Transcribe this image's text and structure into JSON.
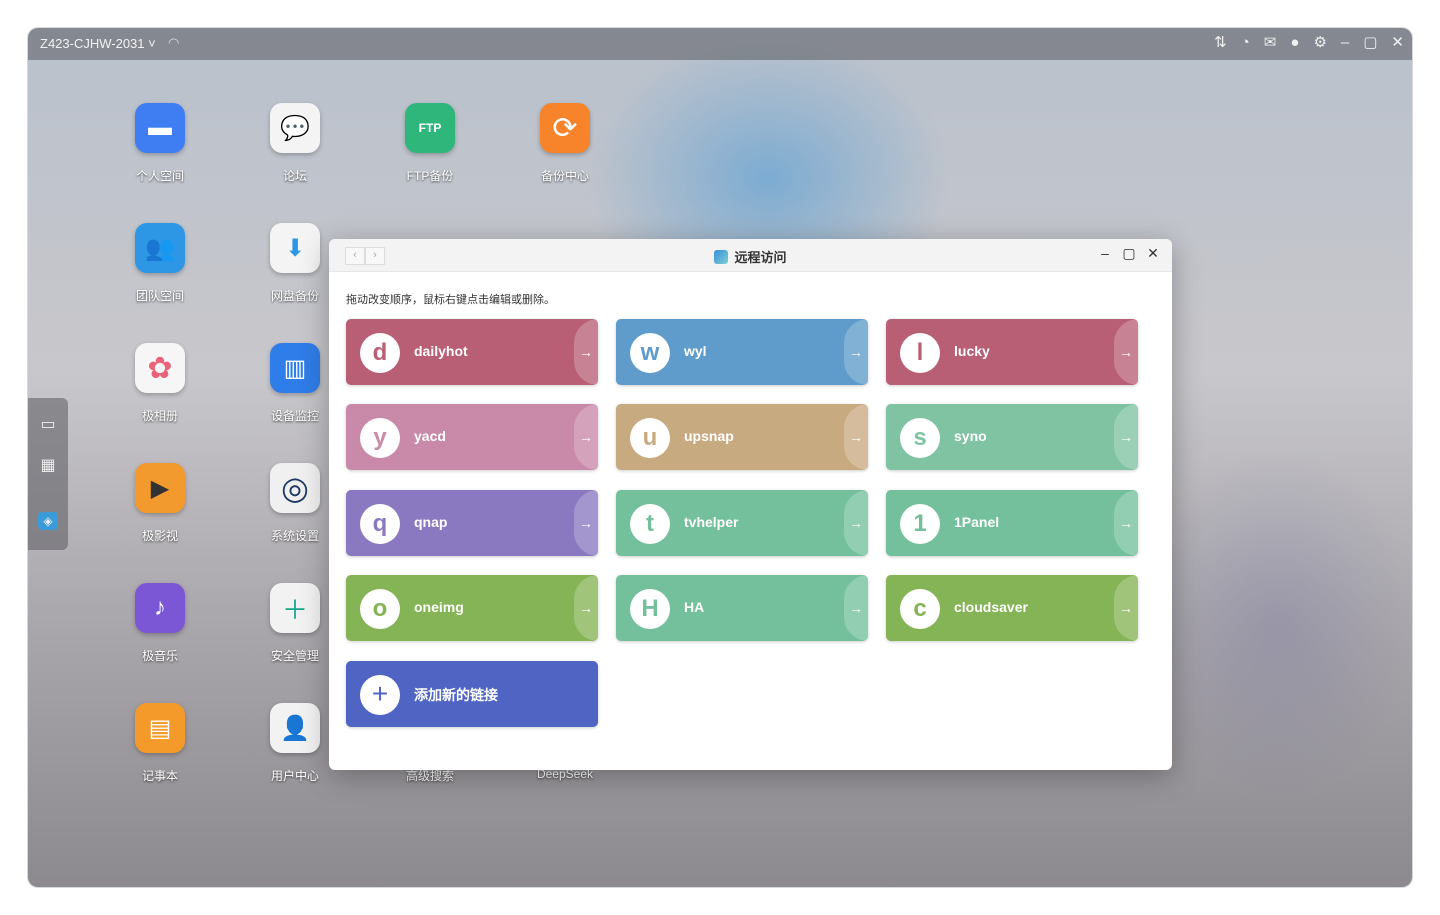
{
  "topbar": {
    "device": "Z423-CJHW-2031 ˅",
    "icons": [
      "transfer-icon",
      "speedometer-icon",
      "mail-icon",
      "user-icon",
      "gear-icon",
      "minimize-icon",
      "maximize-icon",
      "close-icon"
    ]
  },
  "desktop": {
    "apps": [
      {
        "label": "个人空间",
        "glyph": "▬",
        "color": "#3f7ef2"
      },
      {
        "label": "论坛",
        "glyph": "💬",
        "color": "#f4f4f4"
      },
      {
        "label": "FTP备份",
        "glyph": "FTP",
        "color": "#2fb67a"
      },
      {
        "label": "备份中心",
        "glyph": "⟳",
        "color": "#f7842a"
      },
      {
        "label": "团队空间",
        "glyph": "👥",
        "color": "#2e97e5"
      },
      {
        "label": "网盘备份",
        "glyph": "⬇",
        "color": "#f4f4f4"
      },
      {
        "label": "极相册",
        "glyph": "✿",
        "color": "#f6f6f6"
      },
      {
        "label": "设备监控",
        "glyph": "▥",
        "color": "#2f7de8"
      },
      {
        "label": "极影视",
        "glyph": "▶",
        "color": "#f29a2e"
      },
      {
        "label": "系统设置",
        "glyph": "◎",
        "color": "#f0f0f0"
      },
      {
        "label": "极音乐",
        "glyph": "♪",
        "color": "#7b57d6"
      },
      {
        "label": "安全管理",
        "glyph": "＋",
        "color": "#f2f2f2"
      },
      {
        "label": "记事本",
        "glyph": "▤",
        "color": "#f49a2a"
      },
      {
        "label": "用户中心",
        "glyph": "👤",
        "color": "#f2f2f2"
      },
      {
        "label": "高级搜索",
        "glyph": "",
        "color": ""
      },
      {
        "label": "DeepSeek",
        "glyph": "",
        "color": ""
      }
    ]
  },
  "window": {
    "title": "远程访问",
    "nav_back": "‹",
    "nav_forward": "›",
    "minimize": "–",
    "maximize": "▢",
    "close": "✕",
    "hint": "拖动改变顺序，鼠标右键点击编辑或删除。",
    "cards": [
      {
        "letter": "d",
        "name": "dailyhot",
        "color": "#b85f75"
      },
      {
        "letter": "w",
        "name": "wyl",
        "color": "#5f9bcb"
      },
      {
        "letter": "l",
        "name": "lucky",
        "color": "#b85f75"
      },
      {
        "letter": "y",
        "name": "yacd",
        "color": "#c88aa8"
      },
      {
        "letter": "u",
        "name": "upsnap",
        "color": "#c8aa80"
      },
      {
        "letter": "s",
        "name": "syno",
        "color": "#7fc3a3"
      },
      {
        "letter": "q",
        "name": "qnap",
        "color": "#8a79c1"
      },
      {
        "letter": "t",
        "name": "tvhelper",
        "color": "#74c09c"
      },
      {
        "letter": "1",
        "name": "1Panel",
        "color": "#74c09c"
      },
      {
        "letter": "o",
        "name": "oneimg",
        "color": "#84b455"
      },
      {
        "letter": "H",
        "name": "HA",
        "color": "#74c09c"
      },
      {
        "letter": "c",
        "name": "cloudsaver",
        "color": "#84b455"
      }
    ],
    "arrow": "→",
    "add": {
      "plus": "+",
      "label": "添加新的链接"
    }
  }
}
